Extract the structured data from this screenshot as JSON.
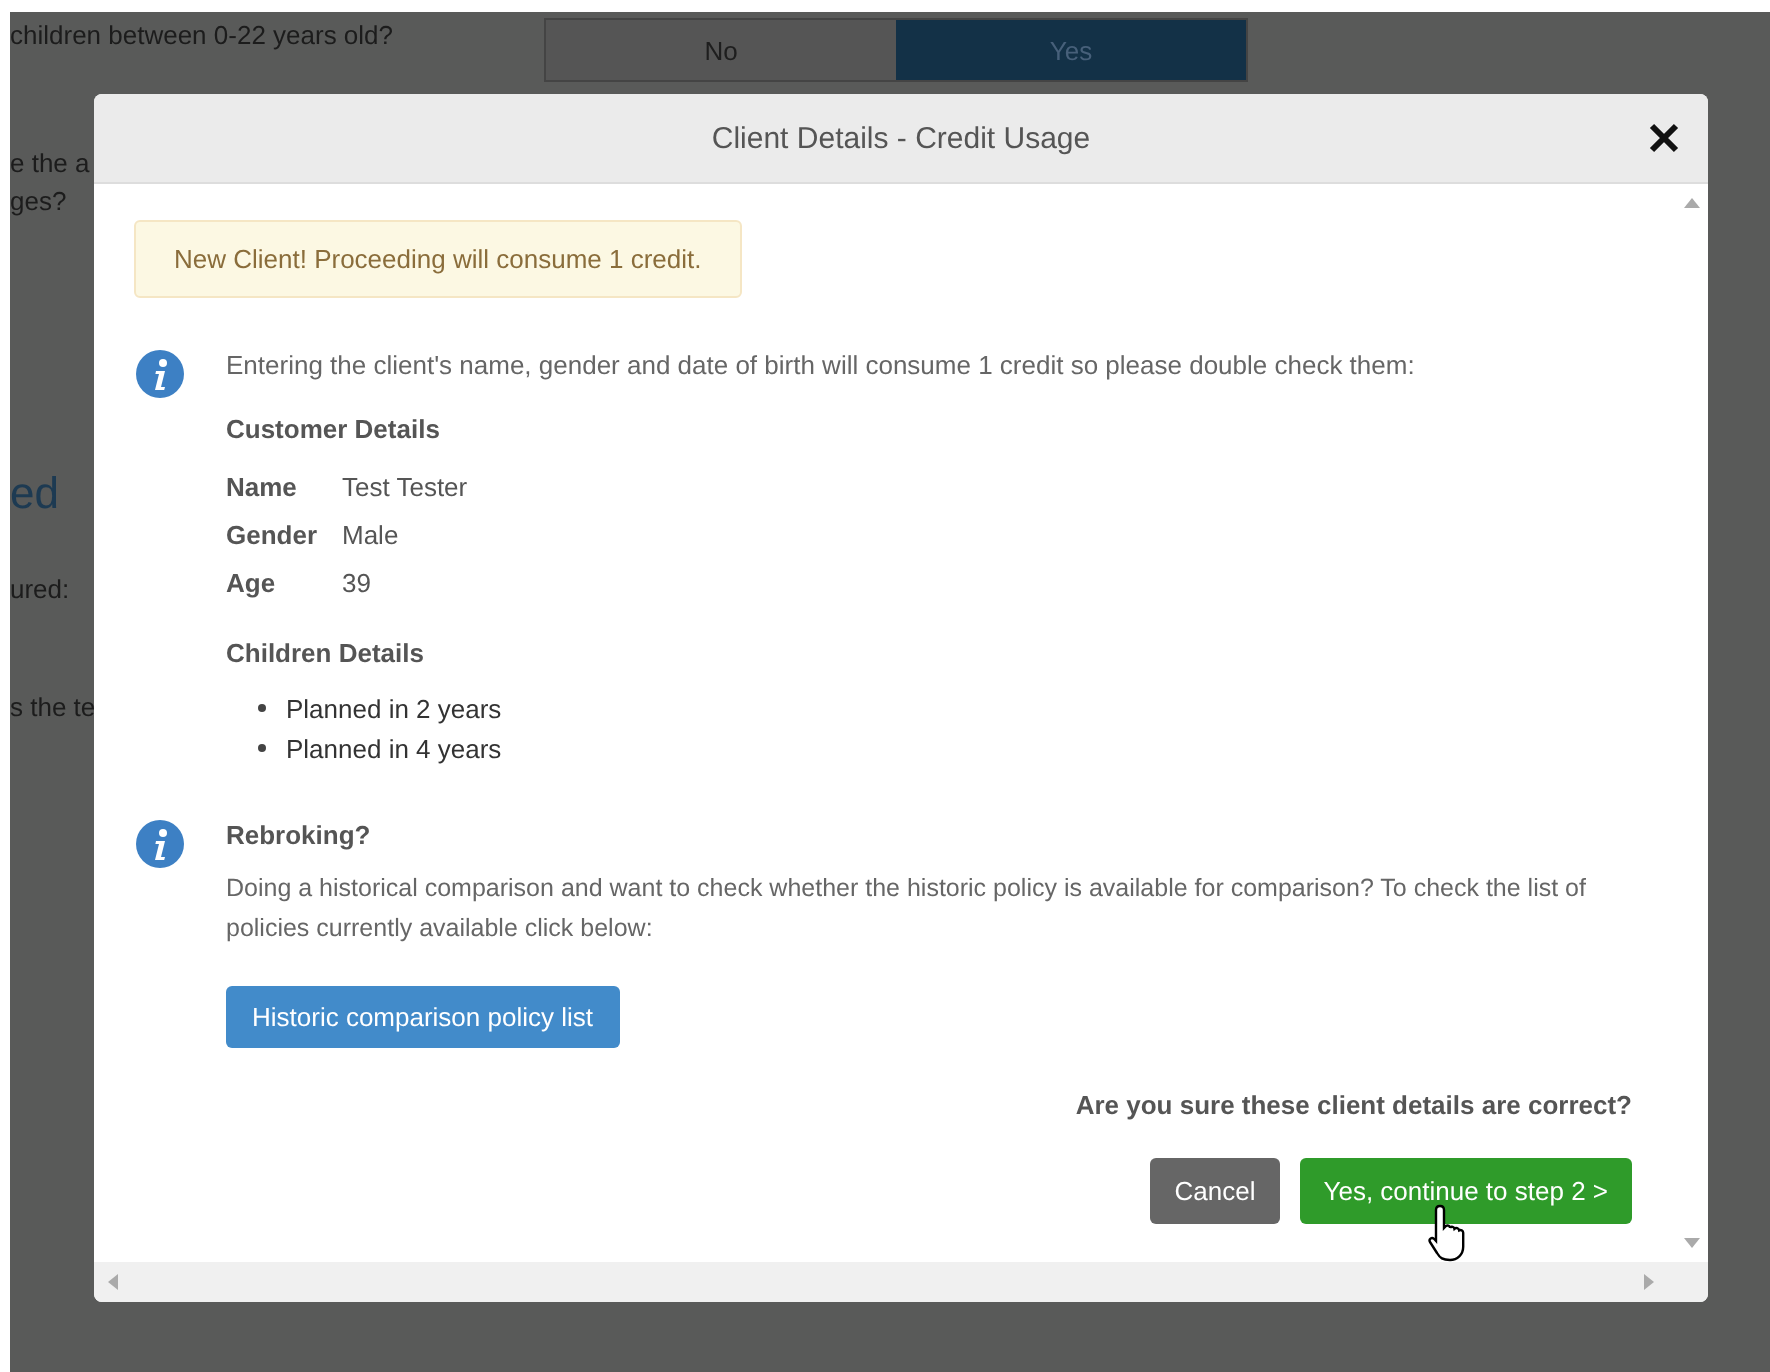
{
  "background": {
    "question": "children between 0-22 years old?",
    "toggle": [
      {
        "label": "No",
        "selected": false
      },
      {
        "label": "Yes",
        "selected": true
      }
    ],
    "fragments": [
      {
        "text": "e the a",
        "kind": "text"
      },
      {
        "text": "ges?",
        "kind": "text"
      },
      {
        "text": "ed",
        "kind": "heading"
      },
      {
        "text": "ured:",
        "kind": "text"
      },
      {
        "text": "s the te",
        "kind": "text"
      }
    ]
  },
  "dialog": {
    "title": "Client Details - Credit Usage",
    "notice": "New Client! Proceeding will consume 1 credit.",
    "intro": "Entering the client's name, gender and date of birth will consume 1 credit so please double check them:",
    "customer_details": {
      "heading": "Customer Details",
      "fields": [
        {
          "label": "Name",
          "value": "Test Tester"
        },
        {
          "label": "Gender",
          "value": "Male"
        },
        {
          "label": "Age",
          "value": "39"
        }
      ]
    },
    "children_details": {
      "heading": "Children Details",
      "items": [
        "Planned in 2 years",
        "Planned in 4 years"
      ]
    },
    "rebroking": {
      "heading": "Rebroking?",
      "text": "Doing a historical comparison and want to check whether the historic policy is available for comparison? To check the list of policies currently available click below:",
      "button": "Historic comparison policy list"
    },
    "confirm_question": "Are you sure these client details are correct?",
    "buttons": [
      {
        "label": "Cancel",
        "kind": "secondary"
      },
      {
        "label": "Yes, continue to step 2 >",
        "kind": "primary"
      }
    ]
  }
}
